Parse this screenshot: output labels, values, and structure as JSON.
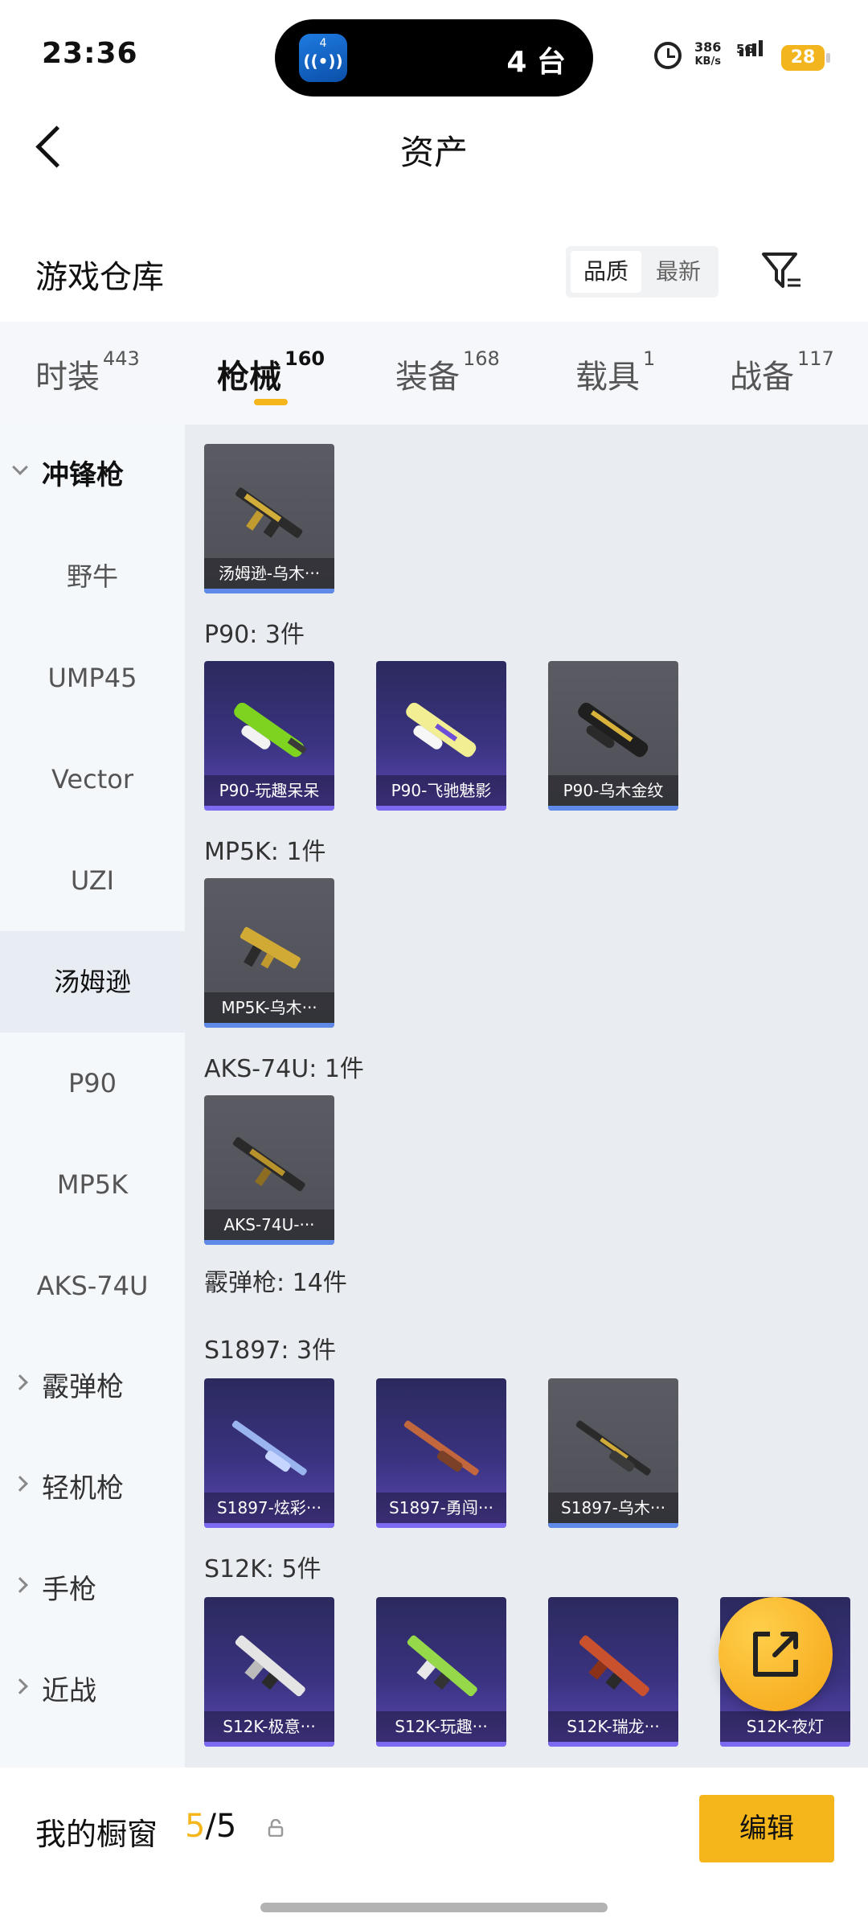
{
  "status_bar": {
    "time": "23:36",
    "island_count": "4 台",
    "island_badge": "4",
    "net_speed_value": "386",
    "net_speed_unit": "KB/s",
    "network": "5G",
    "battery": "28"
  },
  "header": {
    "title": "资产"
  },
  "warehouse": {
    "title": "游戏仓库",
    "sort_quality": "品质",
    "sort_newest": "最新"
  },
  "tabs": [
    {
      "label": "时装",
      "count": "443"
    },
    {
      "label": "枪械",
      "count": "160"
    },
    {
      "label": "装备",
      "count": "168"
    },
    {
      "label": "载具",
      "count": "1"
    },
    {
      "label": "战备",
      "count": "117"
    }
  ],
  "sidebar": {
    "cat_smg": "冲锋枪",
    "smg_items": [
      "野牛",
      "UMP45",
      "Vector",
      "UZI",
      "汤姆逊",
      "P90",
      "MP5K",
      "AKS-74U"
    ],
    "cat_shotgun": "霰弹枪",
    "cat_lmg": "轻机枪",
    "cat_pistol": "手枪",
    "cat_melee": "近战"
  },
  "content": {
    "thompson_card": "汤姆逊-乌木···",
    "p90_label": "P90: 3件",
    "p90_cards": [
      "P90-玩趣呆呆",
      "P90-飞驰魅影",
      "P90-乌木金纹"
    ],
    "mp5k_label": "MP5K: 1件",
    "mp5k_card": "MP5K-乌木···",
    "aks_label": "AKS-74U: 1件",
    "aks_card": "AKS-74U-···",
    "shotgun_label": "霰弹枪: 14件",
    "s1897_label": "S1897: 3件",
    "s1897_cards": [
      "S1897-炫彩···",
      "S1897-勇闯···",
      "S1897-乌木···"
    ],
    "s12k_label": "S12K: 5件",
    "s12k_cards": [
      "S12K-极意···",
      "S12K-玩趣···",
      "S12K-瑞龙···",
      "S12K-夜灯"
    ]
  },
  "bottom": {
    "showcase_label": "我的橱窗",
    "showcase_used": "5",
    "showcase_sep_total": "/5",
    "edit_label": "编辑"
  },
  "colors": {
    "accent": "#f5b61c",
    "purple_card": "#3a3380",
    "grey_card": "#4e4f57"
  }
}
